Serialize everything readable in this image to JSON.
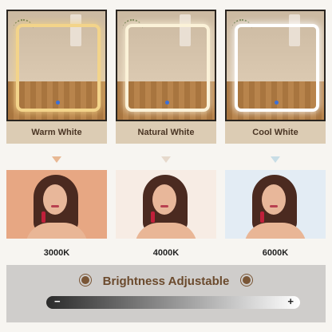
{
  "mirrors": [
    {
      "label": "Warm White",
      "light_color": "#f3d48a",
      "arrow_color": "#e8b893"
    },
    {
      "label": "Natural White",
      "light_color": "#fbf2d8",
      "arrow_color": "#e6d9cc"
    },
    {
      "label": "Cool White",
      "light_color": "#ffffff",
      "arrow_color": "#c8dde6"
    }
  ],
  "photos": [
    {
      "temp": "3000K",
      "bg_color": "#e7a783"
    },
    {
      "temp": "4000K",
      "bg_color": "#f7ece4"
    },
    {
      "temp": "6000K",
      "bg_color": "#e3ecf4"
    }
  ],
  "brightness": {
    "title": "Brightness Adjustable",
    "minus": "−",
    "plus": "+",
    "icon": "sun-icon"
  }
}
